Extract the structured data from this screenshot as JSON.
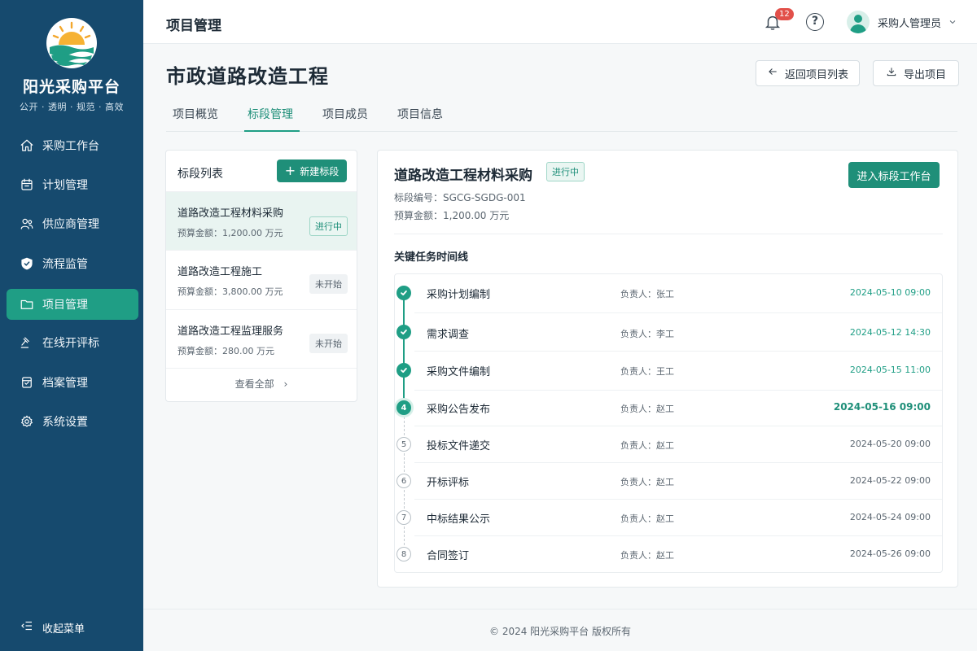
{
  "sidebar": {
    "brand": "阳光采购平台",
    "slogan": "公开 · 透明 · 规范 · 高效",
    "items": [
      {
        "label": "采购工作台",
        "icon": "home-icon"
      },
      {
        "label": "计划管理",
        "icon": "calendar-icon"
      },
      {
        "label": "供应商管理",
        "icon": "users-icon"
      },
      {
        "label": "流程监管",
        "icon": "shield-check-icon"
      },
      {
        "label": "项目管理",
        "icon": "folder-icon",
        "active": true
      },
      {
        "label": "在线开评标",
        "icon": "gavel-icon"
      },
      {
        "label": "档案管理",
        "icon": "archive-icon"
      },
      {
        "label": "系统设置",
        "icon": "gear-icon"
      }
    ],
    "collapse_label": "收起菜单"
  },
  "header": {
    "title": "项目管理",
    "notification_count": "12",
    "help_glyph": "?",
    "user_name": "采购人管理员"
  },
  "main": {
    "title": "市政道路改造工程",
    "back_button": "返回项目列表",
    "export_button": "导出项目",
    "tabs": [
      "项目概览",
      "标段管理",
      "项目成员",
      "信息"
    ],
    "tab_labels": [
      "项目概览",
      "标段管理",
      "项目成员",
      "项目信息"
    ],
    "active_tab": "标段管理"
  },
  "segment_list": {
    "title": "标段列表",
    "new_button": "新建标段",
    "view_all": "查看全部",
    "items": [
      {
        "name": "道路改造工程材料采购",
        "budget": "预算金额：1,200.00 万元",
        "status": "进行中"
      },
      {
        "name": "道路改造工程施工",
        "budget": "预算金额：3,800.00 万元",
        "status": "未开始"
      },
      {
        "name": "道路改造工程监理服务",
        "budget": "预算金额：280.00 万元",
        "status": "未开始"
      }
    ]
  },
  "detail": {
    "name": "道路改造工程材料采购",
    "status": "进行中",
    "code": "标段编号：SGCG-SGDG-001",
    "budget": "预算金额：1,200.00 万元",
    "enter_button": "进入标段工作台",
    "timeline_title": "关键任务时间线",
    "tasks": [
      {
        "step": "1",
        "state": "done",
        "name": "采购计划编制",
        "owner": "负责人：张工",
        "time": "2024-05-10 09:00"
      },
      {
        "step": "2",
        "state": "done",
        "name": "需求调查",
        "owner": "负责人：李工",
        "time": "2024-05-12 14:30"
      },
      {
        "step": "3",
        "state": "done",
        "name": "采购文件编制",
        "owner": "负责人：王工",
        "time": "2024-05-15 11:00"
      },
      {
        "step": "4",
        "state": "current",
        "name": "采购公告发布",
        "owner": "负责人：赵工",
        "time": "2024-05-16 09:00"
      },
      {
        "step": "5",
        "state": "todo",
        "name": "投标文件递交",
        "owner": "负责人：赵工",
        "time": "2024-05-20 09:00"
      },
      {
        "step": "6",
        "state": "todo",
        "name": "开标评标",
        "owner": "负责人：赵工",
        "time": "2024-05-22 09:00"
      },
      {
        "step": "7",
        "state": "todo",
        "name": "中标结果公示",
        "owner": "负责人：赵工",
        "time": "2024-05-24 09:00"
      },
      {
        "step": "8",
        "state": "todo",
        "name": "合同签订",
        "owner": "负责人：赵工",
        "time": "2024-05-26 09:00"
      }
    ]
  },
  "footer": {
    "copyright": "© 2024 阳光采购平台 版权所有"
  },
  "colors": {
    "sidebar": "#164a6e",
    "accent": "#1f9e85",
    "accent_dark": "#1f8f79",
    "badge": "#e2504a"
  }
}
